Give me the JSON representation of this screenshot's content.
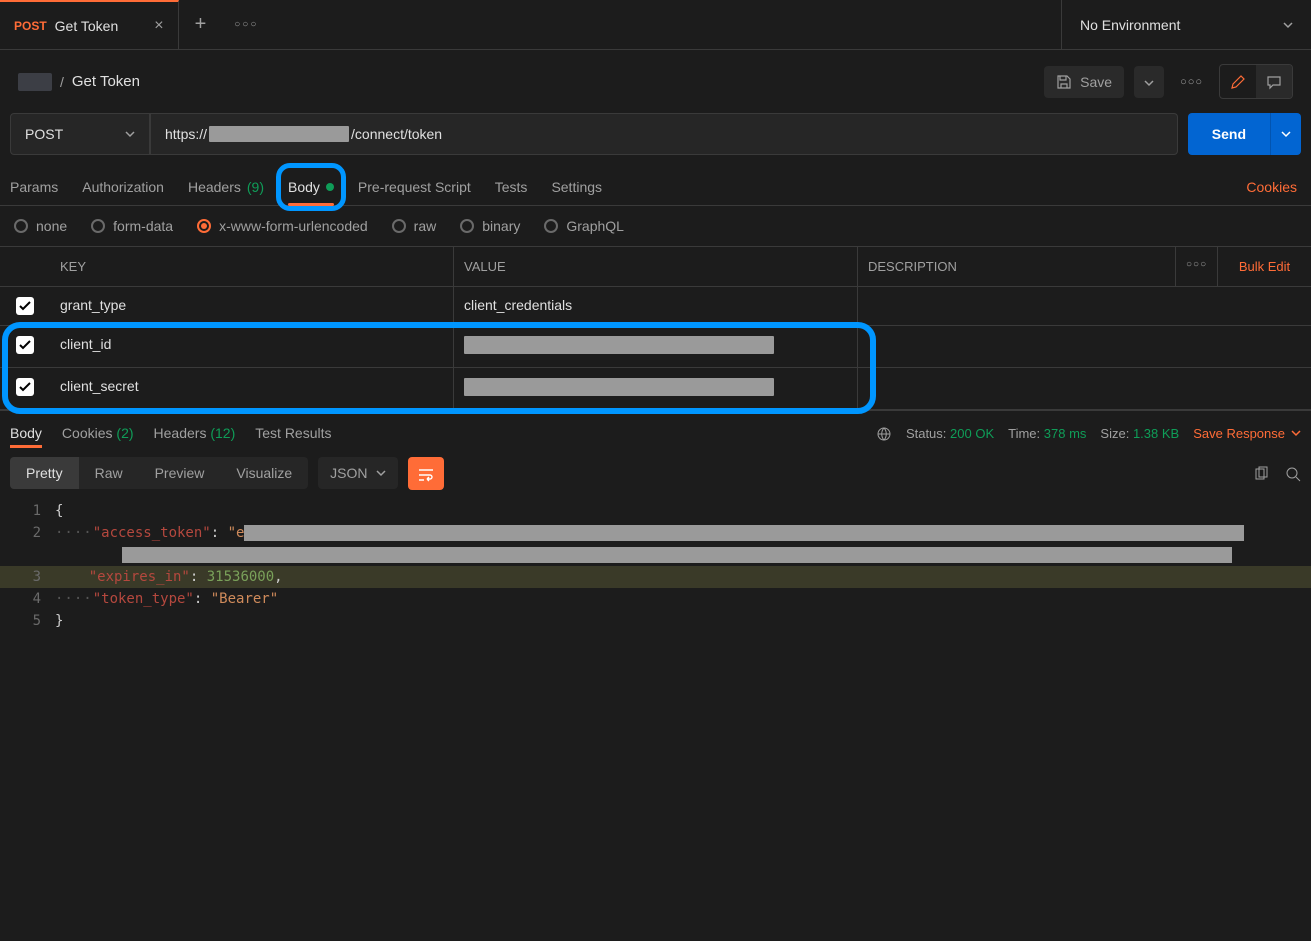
{
  "tabs": {
    "active": {
      "method": "POST",
      "title": "Get Token"
    }
  },
  "env": {
    "label": "No Environment"
  },
  "breadcrumb": {
    "title": "Get Token"
  },
  "header_actions": {
    "save": "Save"
  },
  "request": {
    "method": "POST",
    "url_prefix": "https://",
    "url_suffix": "/connect/token",
    "send": "Send"
  },
  "req_tabs": {
    "params": "Params",
    "auth": "Authorization",
    "headers": "Headers",
    "headers_count": "(9)",
    "body": "Body",
    "prerequest": "Pre-request Script",
    "tests": "Tests",
    "settings": "Settings",
    "cookies": "Cookies"
  },
  "body_types": {
    "none": "none",
    "formdata": "form-data",
    "xwww": "x-www-form-urlencoded",
    "raw": "raw",
    "binary": "binary",
    "graphql": "GraphQL"
  },
  "kv": {
    "header_key": "KEY",
    "header_value": "VALUE",
    "header_desc": "DESCRIPTION",
    "bulk": "Bulk Edit",
    "rows": [
      {
        "key": "grant_type",
        "value": "client_credentials"
      },
      {
        "key": "client_id",
        "value": ""
      },
      {
        "key": "client_secret",
        "value": ""
      }
    ]
  },
  "resp_tabs": {
    "body": "Body",
    "cookies": "Cookies",
    "cookies_count": "(2)",
    "headers": "Headers",
    "headers_count": "(12)",
    "tests": "Test Results"
  },
  "resp_meta": {
    "status_label": "Status:",
    "status_value": "200 OK",
    "time_label": "Time:",
    "time_value": "378 ms",
    "size_label": "Size:",
    "size_value": "1.38 KB",
    "save_response": "Save Response"
  },
  "resp_view": {
    "pretty": "Pretty",
    "raw": "Raw",
    "preview": "Preview",
    "visualize": "Visualize",
    "format": "JSON"
  },
  "resp_body": {
    "access_token_key": "\"access_token\"",
    "access_token_start": "\"e",
    "expires_in_key": "\"expires_in\"",
    "expires_in_value": "31536000",
    "token_type_key": "\"token_type\"",
    "token_type_value": "\"Bearer\""
  }
}
